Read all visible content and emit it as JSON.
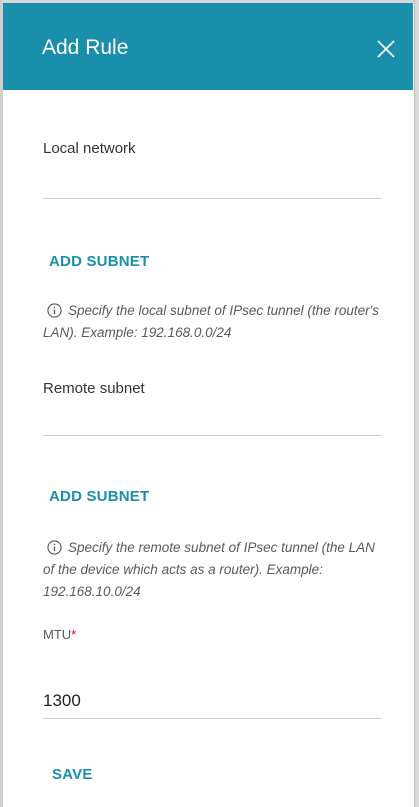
{
  "header": {
    "title": "Add Rule",
    "close_icon": "close-icon",
    "background_color": "#1a8fab"
  },
  "local_network": {
    "label": "Local network",
    "value": "",
    "add_subnet_label": "ADD SUBNET",
    "hint": "Specify the local subnet of IPsec tunnel (the router's LAN). Example: 192.168.0.0/24"
  },
  "remote_subnet": {
    "label": "Remote subnet",
    "value": "",
    "add_subnet_label": "ADD SUBNET",
    "hint": "Specify the remote subnet of IPsec tunnel (the LAN of the device which acts as a router). Example: 192.168.10.0/24"
  },
  "mtu": {
    "label": "MTU",
    "required_mark": "*",
    "value": "1300"
  },
  "actions": {
    "save_label": "SAVE"
  },
  "colors": {
    "accent": "#1a8fab",
    "required": "#d0021b"
  }
}
